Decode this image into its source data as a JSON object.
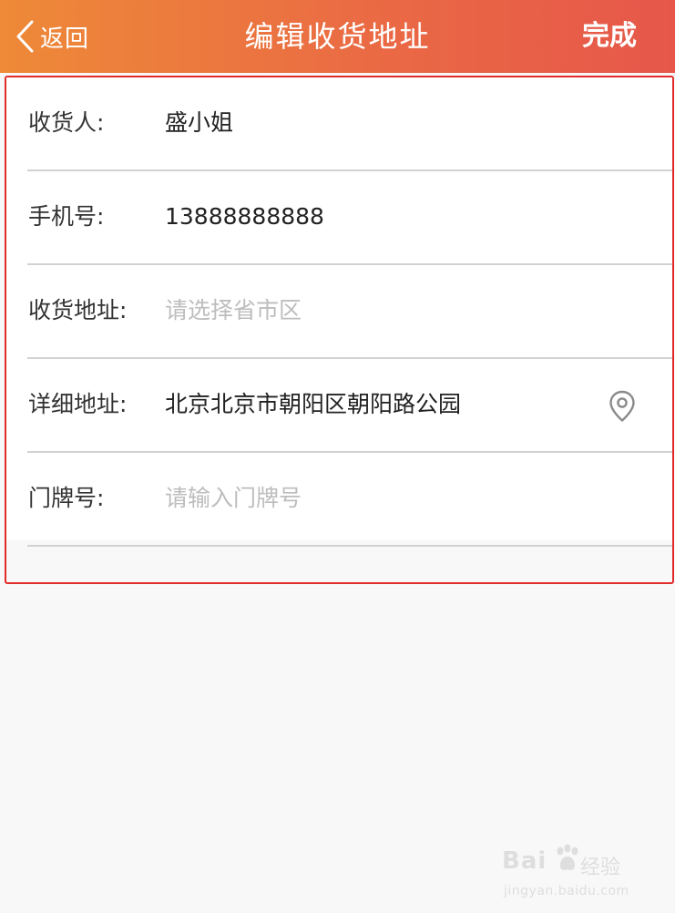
{
  "header": {
    "back_label": "返回",
    "title": "编辑收货地址",
    "done_label": "完成"
  },
  "form": {
    "rows": [
      {
        "label": "收货人:",
        "value": "盛小姐",
        "placeholder": ""
      },
      {
        "label": "手机号:",
        "value": "13888888888",
        "placeholder": ""
      },
      {
        "label": "收货地址:",
        "value": "",
        "placeholder": "请选择省市区"
      },
      {
        "label": "详细地址:",
        "value": "北京北京市朝阳区朝阳路公园",
        "placeholder": ""
      },
      {
        "label": "门牌号:",
        "value": "",
        "placeholder": "请输入门牌号"
      }
    ]
  },
  "icons": {
    "back": "chevron-left-icon",
    "location": "location-pin-icon"
  },
  "colors": {
    "header_start": "#ee8a38",
    "header_end": "#e6574a",
    "highlight_border": "#e22b2b",
    "placeholder": "#bdbdbd"
  },
  "watermark": {
    "logo_text": "Bai",
    "logo_suffix": "经验",
    "url": "jingyan.baidu.com"
  }
}
